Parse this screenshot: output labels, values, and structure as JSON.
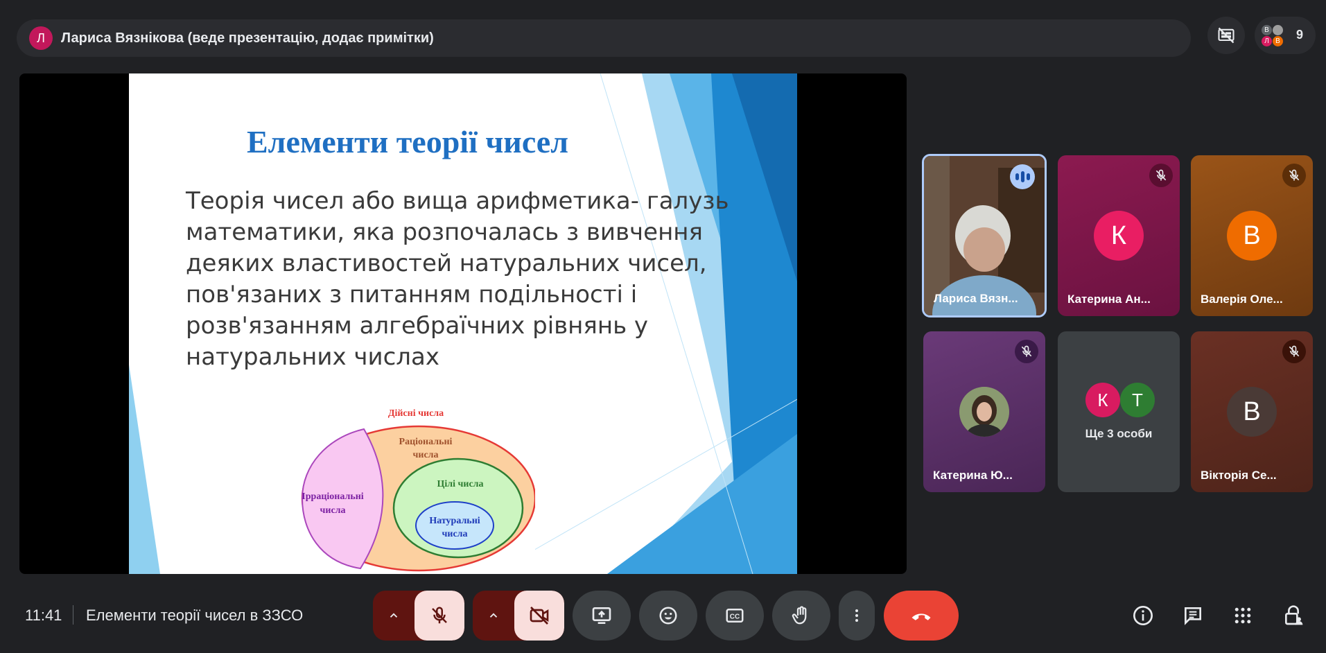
{
  "presenter": {
    "initial": "Л",
    "text": "Лариса Вязнікова (веде презентацію, додає примітки)"
  },
  "participants_pill": {
    "count": "9",
    "mini_avatars": [
      "В",
      "Л",
      "В"
    ]
  },
  "slide": {
    "title": "Елементи теорії чисел",
    "body": "Теорія чисел або вища арифметика- галузь математики, яка розпочалась з вивчення деяких властивостей натуральних чисел, пов'язаних з питанням подільності і розв'язанням алгебраїчних рівнянь у натуральних числах",
    "diagram": {
      "real": "Дійсні числа",
      "rational_1": "Раціональні",
      "rational_2": "числа",
      "irrational_1": "Ірраціональні",
      "irrational_2": "числа",
      "integers": "Цілі числа",
      "natural_1": "Натуральні",
      "natural_2": "числа"
    }
  },
  "tiles": [
    {
      "name": "Лариса Вязн...",
      "state": "speaking",
      "video": true
    },
    {
      "name": "Катерина Ан...",
      "initial": "К",
      "avatar_color": "#e91e63",
      "bg": "#7a1346",
      "muted": true
    },
    {
      "name": "Валерія Оле...",
      "initial": "В",
      "avatar_color": "#ef6c00",
      "bg": "#8a4a14",
      "muted": true
    },
    {
      "name": "Катерина Ю...",
      "bg": "#5a2f66",
      "muted": true,
      "photo": true
    },
    {
      "more_label": "Ще 3 особи",
      "initials": [
        "К",
        "Т"
      ],
      "colors": [
        "#d81b60",
        "#2e7d32"
      ]
    },
    {
      "name": "Вікторія Се...",
      "initial": "В",
      "avatar_color": "#4a3a36",
      "bg": "#5d2e22",
      "muted": true
    }
  ],
  "footer": {
    "time": "11:41",
    "meeting_title": "Елементи теорії чисел в ЗЗСО"
  },
  "colors": {
    "background": "#202124",
    "end_call": "#ea4335",
    "muted_ctrl": "#f9dedc"
  }
}
